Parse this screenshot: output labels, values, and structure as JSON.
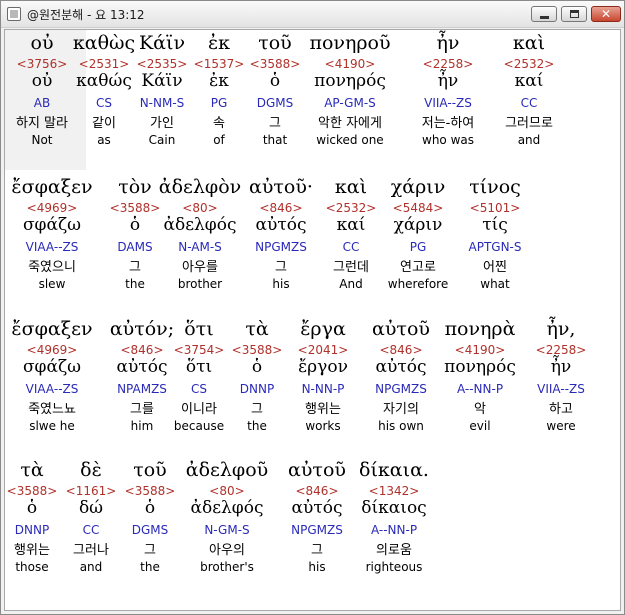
{
  "window": {
    "title": "@원전분해 - 요 13:12",
    "minimize_icon": "minimize-icon",
    "maximize_icon": "maximize-icon",
    "close_icon": "close-icon",
    "close_glyph": "✕"
  },
  "lines": [
    [
      {
        "greek": "οὐ",
        "strong": "<3756>",
        "lemma": "οὐ",
        "parse": "AB",
        "korean": "하지 말라",
        "english": "Not",
        "selected": true
      },
      {
        "greek": "καθὼς",
        "strong": "<2531>",
        "lemma": "καθώς",
        "parse": "CS",
        "korean": "같이",
        "english": "as"
      },
      {
        "greek": "Κάϊν",
        "strong": "<2535>",
        "lemma": "Κάϊν",
        "parse": "N-NM-S",
        "korean": "가인",
        "english": "Cain"
      },
      {
        "greek": "ἐκ",
        "strong": "<1537>",
        "lemma": "ἐκ",
        "parse": "PG",
        "korean": "속",
        "english": "of"
      },
      {
        "greek": "τοῦ",
        "strong": "<3588>",
        "lemma": "ὁ",
        "parse": "DGMS",
        "korean": "그",
        "english": "that"
      },
      {
        "greek": "πονηροῦ",
        "strong": "<4190>",
        "lemma": "πονηρός",
        "parse": "AP-GM-S",
        "korean": "악한 자에게",
        "english": "wicked one"
      },
      {
        "greek": "ἦν",
        "strong": "<2258>",
        "lemma": "ἦν",
        "parse": "VIIA--ZS",
        "korean": "저는-하여",
        "english": "who was"
      },
      {
        "greek": "καὶ",
        "strong": "<2532>",
        "lemma": "καί",
        "parse": "CC",
        "korean": "그러므로",
        "english": "and"
      }
    ],
    [
      {
        "greek": "ἔσφαξεν",
        "strong": "<4969>",
        "lemma": "σφάζω",
        "parse": "VIAA--ZS",
        "korean": "죽였으니",
        "english": "slew"
      },
      {
        "greek": "τὸν",
        "strong": "<3588>",
        "lemma": "ὁ",
        "parse": "DAMS",
        "korean": "그",
        "english": "the"
      },
      {
        "greek": "ἀδελφὸν",
        "strong": "<80>",
        "lemma": "ἀδελφός",
        "parse": "N-AM-S",
        "korean": "아우를",
        "english": "brother"
      },
      {
        "greek": "αὐτοῦ·",
        "strong": "<846>",
        "lemma": "αὐτός",
        "parse": "NPGMZS",
        "korean": "그",
        "english": "his"
      },
      {
        "greek": "καὶ",
        "strong": "<2532>",
        "lemma": "καί",
        "parse": "CC",
        "korean": "그런데",
        "english": "And"
      },
      {
        "greek": "χάριν",
        "strong": "<5484>",
        "lemma": "χάριν",
        "parse": "PG",
        "korean": "연고로",
        "english": "wherefore"
      },
      {
        "greek": "τίνος",
        "strong": "<5101>",
        "lemma": "τίς",
        "parse": "APTGN-S",
        "korean": "어찐",
        "english": "what"
      }
    ],
    [
      {
        "greek": "ἔσφαξεν",
        "strong": "<4969>",
        "lemma": "σφάζω",
        "parse": "VIAA--ZS",
        "korean": "죽였느뇨",
        "english": "slwe he"
      },
      {
        "greek": "αὐτόν;",
        "strong": "<846>",
        "lemma": "αὐτός",
        "parse": "NPAMZS",
        "korean": "그를",
        "english": "him"
      },
      {
        "greek": "ὅτι",
        "strong": "<3754>",
        "lemma": "ὅτι",
        "parse": "CS",
        "korean": "이니라",
        "english": "because"
      },
      {
        "greek": "τὰ",
        "strong": "<3588>",
        "lemma": "ὁ",
        "parse": "DNNP",
        "korean": "그",
        "english": "the"
      },
      {
        "greek": "ἔργα",
        "strong": "<2041>",
        "lemma": "ἔργον",
        "parse": "N-NN-P",
        "korean": "행위는",
        "english": "works"
      },
      {
        "greek": "αὐτοῦ",
        "strong": "<846>",
        "lemma": "αὐτός",
        "parse": "NPGMZS",
        "korean": "자기의",
        "english": "his own"
      },
      {
        "greek": "πονηρὰ",
        "strong": "<4190>",
        "lemma": "πονηρός",
        "parse": "A--NN-P",
        "korean": "악",
        "english": "evil"
      },
      {
        "greek": "ἦν,",
        "strong": "<2258>",
        "lemma": "ἦν",
        "parse": "VIIA--ZS",
        "korean": "하고",
        "english": "were"
      }
    ],
    [
      {
        "greek": "τὰ",
        "strong": "<3588>",
        "lemma": "ὁ",
        "parse": "DNNP",
        "korean": "행위는",
        "english": "those"
      },
      {
        "greek": "δὲ",
        "strong": "<1161>",
        "lemma": "δώ",
        "parse": "CC",
        "korean": "그러나",
        "english": "and"
      },
      {
        "greek": "τοῦ",
        "strong": "<3588>",
        "lemma": "ὁ",
        "parse": "DGMS",
        "korean": "그",
        "english": "the"
      },
      {
        "greek": "ἀδελφοῦ",
        "strong": "<80>",
        "lemma": "ἀδελφός",
        "parse": "N-GM-S",
        "korean": "아우의",
        "english": "brother's"
      },
      {
        "greek": "αὐτοῦ",
        "strong": "<846>",
        "lemma": "αὐτός",
        "parse": "NPGMZS",
        "korean": "그",
        "english": "his"
      },
      {
        "greek": "δίκαια.",
        "strong": "<1342>",
        "lemma": "δίκαιος",
        "parse": "A--NN-P",
        "korean": "의로움",
        "english": "righteous"
      }
    ]
  ]
}
